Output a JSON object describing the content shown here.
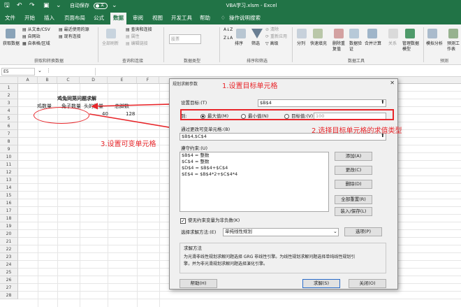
{
  "titlebar": {
    "autosave": "自动保存",
    "autosave_state": "关",
    "window_title": "VBA学习.xlsm  -  Excel",
    "search": "操作说明搜索"
  },
  "menu": [
    "文件",
    "开始",
    "插入",
    "页面布局",
    "公式",
    "数据",
    "审阅",
    "视图",
    "开发工具",
    "帮助"
  ],
  "ribbon": {
    "get_data": "获取数据",
    "from_text": "从文本/CSV",
    "from_web": "自网站",
    "from_table": "自表格/区域",
    "recent": "最近使用的源",
    "existing": "现有连接",
    "group1": "获取和转换数据",
    "refresh_all": "全部刷新",
    "queries": "查询和连接",
    "properties": "属性",
    "edit_links": "编辑链接",
    "group2": "查询和连接",
    "stocks": "股票",
    "group3": "数据类型",
    "sort": "排序",
    "filter": "筛选",
    "clear": "清除",
    "reapply": "重新应用",
    "advanced": "高级",
    "group4": "排序和筛选",
    "text_to_col": "分列",
    "flash_fill": "快速填充",
    "remove_dup": "删除重复值",
    "validation": "数据验证",
    "consolidate": "合并计算",
    "relations": "关系",
    "data_model": "管理数据模型",
    "group5": "数据工具",
    "what_if": "模拟分析",
    "forecast": "预测工作表",
    "group6": "预测"
  },
  "namebox": "E5",
  "sheet": {
    "columns": [
      "A",
      "B",
      "C",
      "D",
      "E",
      "F"
    ],
    "rows": [
      "1",
      "2",
      "3",
      "4",
      "5",
      "6",
      "7",
      "8",
      "9",
      "10",
      "11",
      "12",
      "13",
      "14",
      "15",
      "16",
      "17",
      "18",
      "19",
      "20",
      "21",
      "22",
      "23",
      "24",
      "25",
      "26",
      "27",
      "28"
    ],
    "title": "鸡兔同笼问题求解",
    "r3b": "鸡数量",
    "r3c": "兔子数量",
    "r3d": "头的数量",
    "r3e": "总脚数",
    "r4d": "40",
    "r4e": "128"
  },
  "dialog": {
    "title": "规划求解参数",
    "target_label": "设置目标:(T)",
    "target_value": "$B$4",
    "to_label": "到:",
    "opt_max": "最大值(M)",
    "opt_min": "最小值(N)",
    "opt_value": "目标值:(V)",
    "value_field": "100",
    "vars_label": "通过更改可变单元格:(B)",
    "vars_value": "$B$4,$C$4",
    "constraints_label": "遵守约束:(U)",
    "constraints": [
      "$B$4 = 整数",
      "$C$4 = 整数",
      "$D$4 = $B$4+$C$4",
      "$E$4 = $B$4*2+$C$4*4"
    ],
    "add": "添加(A)",
    "change": "更改(C)",
    "delete": "删除(D)",
    "reset_all": "全部重置(R)",
    "load_save": "装入/保存(L)",
    "nonneg": "使无约束变量为非负数(K)",
    "method_label": "选择求解方法:(E)",
    "method_value": "单纯线性规划",
    "options": "选项(P)",
    "solving_method": "求解方法",
    "desc1": "为光滑非线性规划求解问题选择 GRG 非线性引擎。为线性规划求解问题选择单纯线性规划引",
    "desc2": "擎，并为非光滑规划求解问题选择演化引擎。",
    "help": "帮助(H)",
    "solve": "求解(S)",
    "close": "关闭(O)"
  },
  "annotations": {
    "a1": "1.设置目标单元格",
    "a2": "2.选择目标单元格的求值类型",
    "a3": "3.设置可变单元格"
  },
  "colors": {
    "excel_green": "#217346",
    "annotation_red": "#e8262a"
  }
}
